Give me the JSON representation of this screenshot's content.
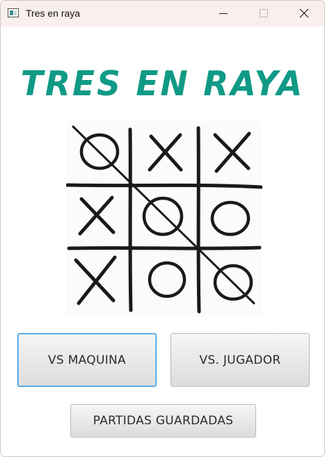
{
  "window": {
    "title": "Tres en raya",
    "controls": [
      "minimize",
      "maximize",
      "close"
    ]
  },
  "main": {
    "heading": "TRES EN RAYA",
    "board_image": {
      "description_icon": "tic-tac-toe-sketch",
      "cells": [
        "O",
        "X",
        "X",
        "X",
        "O",
        "O",
        "X",
        "O",
        "O"
      ]
    },
    "buttons": {
      "vs_maquina": "VS MAQUINA",
      "vs_jugador": "VS. JUGADOR",
      "partidas_guardadas": "PARTIDAS GUARDADAS"
    }
  },
  "colors": {
    "heading": "#109a86",
    "titlebar": "#f9efec",
    "focus_border": "#1f95d9"
  }
}
